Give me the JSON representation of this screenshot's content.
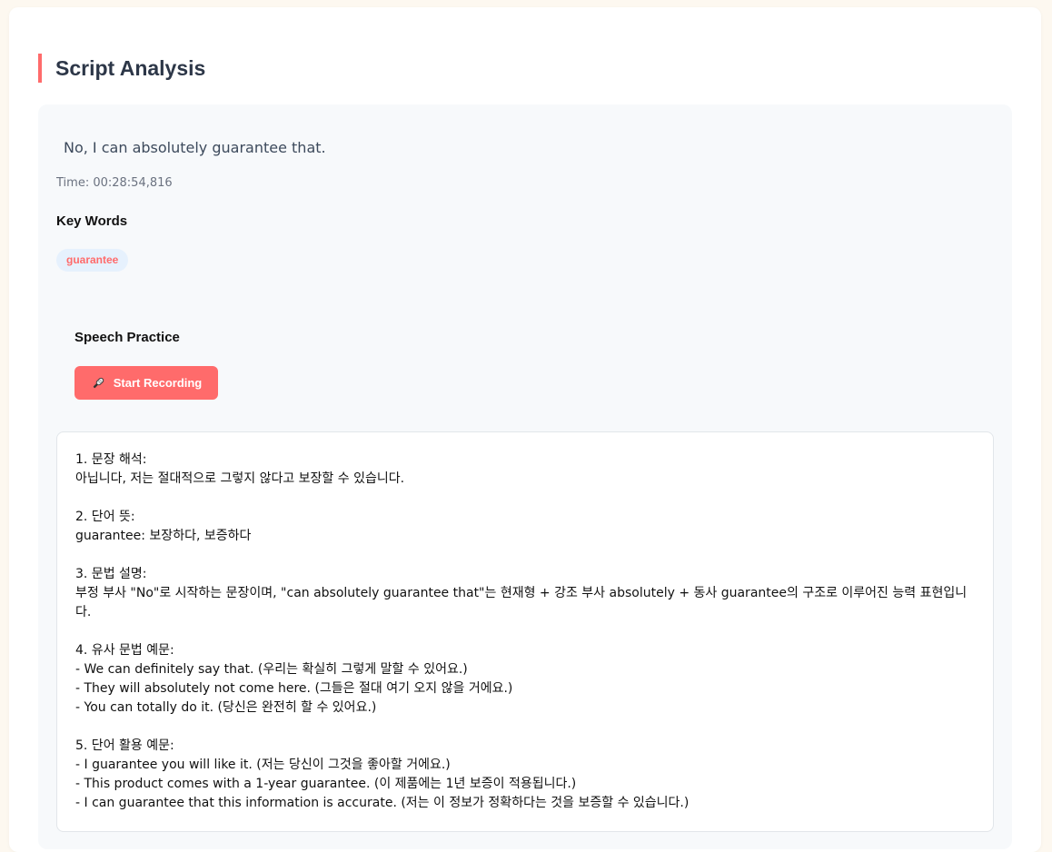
{
  "section": {
    "title": "Script Analysis"
  },
  "script": {
    "sentence": "No, I can absolutely guarantee that.",
    "time": "Time: 00:28:54,816"
  },
  "keywords": {
    "heading": "Key Words",
    "items": [
      "guarantee"
    ]
  },
  "speech": {
    "heading": "Speech Practice",
    "button_label": "Start Recording",
    "button_icon": "microphone-icon"
  },
  "explanation": {
    "text": "1. 문장 해석:\n아닙니다, 저는 절대적으로 그렇지 않다고 보장할 수 있습니다.\n\n2. 단어 뜻:\nguarantee: 보장하다, 보증하다\n\n3. 문법 설명:\n부정 부사 \"No\"로 시작하는 문장이며, \"can absolutely guarantee that\"는 현재형 + 강조 부사 absolutely + 동사 guarantee의 구조로 이루어진 능력 표현입니다.\n\n4. 유사 문법 예문:\n- We can definitely say that. (우리는 확실히 그렇게 말할 수 있어요.)\n- They will absolutely not come here. (그들은 절대 여기 오지 않을 거에요.)\n- You can totally do it. (당신은 완전히 할 수 있어요.)\n\n5. 단어 활용 예문:\n- I guarantee you will like it. (저는 당신이 그것을 좋아할 거에요.)\n- This product comes with a 1-year guarantee. (이 제품에는 1년 보증이 적용됩니다.)\n- I can guarantee that this information is accurate. (저는 이 정보가 정확하다는 것을 보증할 수 있습니다.)"
  },
  "colors": {
    "accent": "#ff6b6b",
    "chip_bg": "#e6f1fd",
    "panel_bg": "#f7f9fb"
  }
}
